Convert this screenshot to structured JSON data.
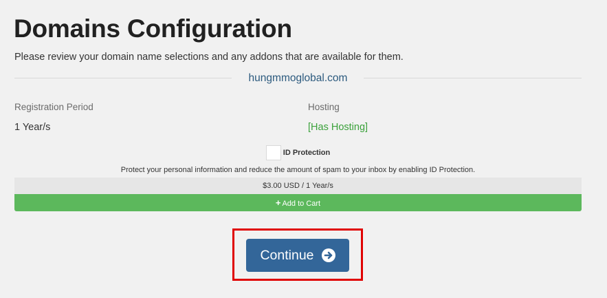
{
  "page": {
    "title": "Domains Configuration",
    "subtitle": "Please review your domain name selections and any addons that are available for them."
  },
  "domain": {
    "name": "hungmmoglobal.com"
  },
  "registration": {
    "label": "Registration Period",
    "value": "1 Year/s"
  },
  "hosting": {
    "label": "Hosting",
    "value": "[Has Hosting]",
    "value_color": "#3aa13a"
  },
  "addon": {
    "name": "ID Protection",
    "checked": false,
    "description": "Protect your personal information and reduce the amount of spam to your inbox by enabling ID Protection.",
    "price": "$3.00 USD / 1 Year/s",
    "cart_label": "Add to Cart",
    "cart_icon": "plus-icon",
    "cart_color": "#5cb85c"
  },
  "actions": {
    "continue_label": "Continue",
    "continue_icon": "arrow-circle-right-icon",
    "continue_color": "#336699",
    "highlight_color": "#e00000"
  }
}
